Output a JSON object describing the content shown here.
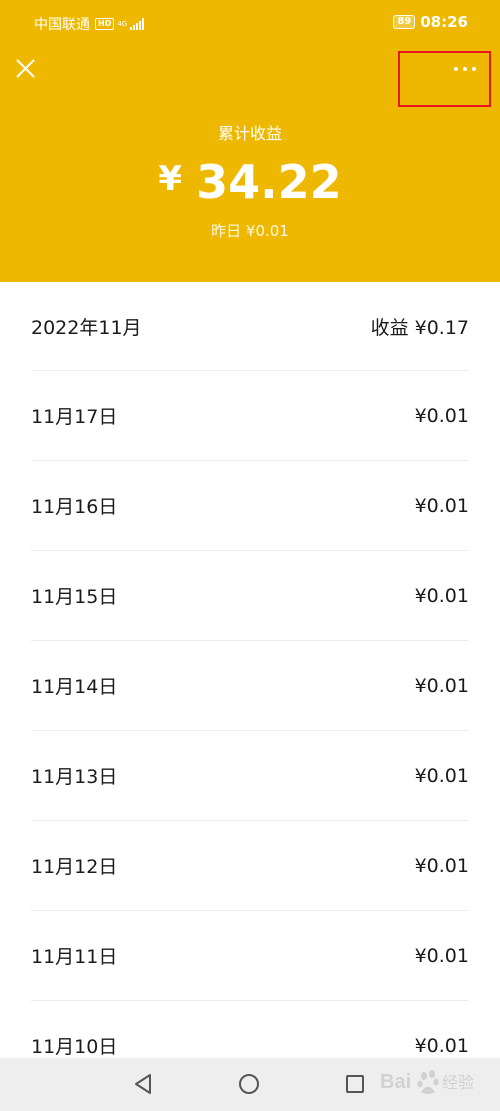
{
  "status_bar": {
    "carrier": "中国联通",
    "hd_badge": "HD",
    "network": "4G",
    "battery": "89",
    "time": "08:26"
  },
  "header": {
    "close_icon": "close-icon",
    "more_icon": "more-dots-icon",
    "total_label": "累计收益",
    "currency_symbol": "¥",
    "total_amount": "34.22",
    "yesterday": "昨日 ¥0.01",
    "background_color": "#efb800",
    "highlight_color": "#e8171a"
  },
  "summary": {
    "month": "2022年11月",
    "earnings": "收益 ¥0.17"
  },
  "daily_earnings": [
    {
      "date": "11月17日",
      "amount": "¥0.01"
    },
    {
      "date": "11月16日",
      "amount": "¥0.01"
    },
    {
      "date": "11月15日",
      "amount": "¥0.01"
    },
    {
      "date": "11月14日",
      "amount": "¥0.01"
    },
    {
      "date": "11月13日",
      "amount": "¥0.01"
    },
    {
      "date": "11月12日",
      "amount": "¥0.01"
    },
    {
      "date": "11月11日",
      "amount": "¥0.01"
    },
    {
      "date": "11月10日",
      "amount": "¥0.01"
    }
  ],
  "nav_bar": {
    "back_icon": "back-triangle-icon",
    "home_icon": "home-circle-icon",
    "recent_icon": "recent-apps-square-icon"
  },
  "watermark": {
    "text": "Bai du 经验"
  }
}
